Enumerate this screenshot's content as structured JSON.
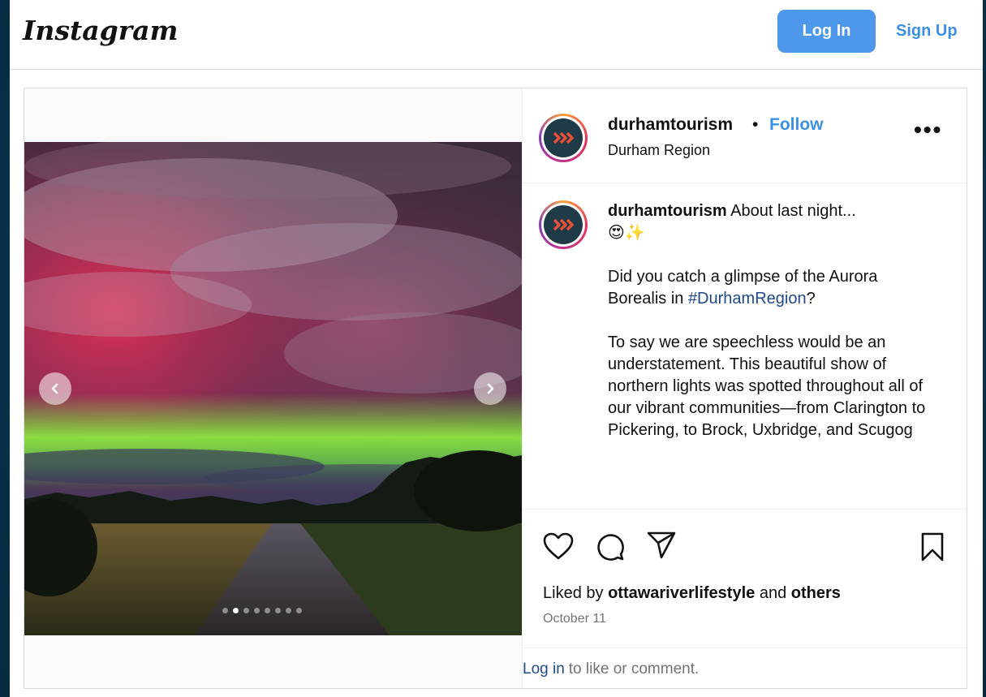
{
  "header": {
    "logo_text": "Instagram",
    "login_label": "Log In",
    "signup_label": "Sign Up"
  },
  "post": {
    "username": "durhamtourism",
    "separator": "•",
    "follow_label": "Follow",
    "location": "Durham Region",
    "more_label": "•••",
    "caption": {
      "username": "durhamtourism",
      "first_line": "About last night...",
      "emoji": "😍✨",
      "paragraph1_prefix": "Did you catch a glimpse of the Aurora Borealis in ",
      "hashtag": "#DurhamRegion",
      "paragraph1_suffix": "?",
      "paragraph2": "To say we are speechless would be an understatement. This beautiful show of northern lights was spotted throughout all of our vibrant communities—from Clarington to Pickering, to Brock, Uxbridge, and Scugog"
    },
    "likes_prefix": "Liked by ",
    "likes_user": "ottawariverlifestyle",
    "likes_middle": " and ",
    "likes_others": "others",
    "date": "October 11",
    "login_link": "Log in",
    "login_suffix": "to like or comment.",
    "carousel": {
      "slide_count": 8,
      "active_index": 1
    }
  },
  "icons": [
    "chevron-left-icon",
    "chevron-right-icon",
    "heart-icon",
    "comment-icon",
    "share-icon",
    "bookmark-icon",
    "more-icon"
  ],
  "colors": {
    "primary_button": "#4d98ea",
    "link_blue": "#3b90e6",
    "hashtag": "#1f4a8a",
    "muted_text": "#737373"
  }
}
